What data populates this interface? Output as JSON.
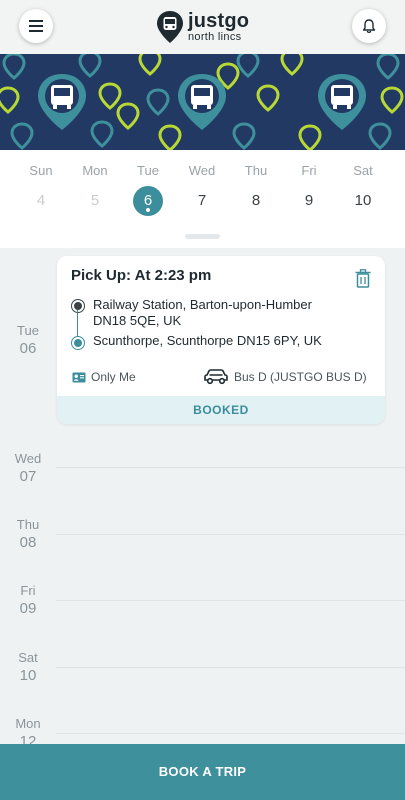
{
  "header": {
    "logo_main": "justgo",
    "logo_sub": "north lincs",
    "menu_icon": "hamburger-menu-icon",
    "bell_icon": "bell-icon"
  },
  "colors": {
    "accent": "#3d8e9c",
    "banner_bg": "#223a63",
    "pin_lime": "#b8d935",
    "pin_teal": "#3e909c",
    "agenda_bg": "#eff2f3",
    "status_bg": "#e2f1f4"
  },
  "week": {
    "days": [
      {
        "name": "Sun",
        "num": "4",
        "state": "past"
      },
      {
        "name": "Mon",
        "num": "5",
        "state": "past"
      },
      {
        "name": "Tue",
        "num": "6",
        "state": "selected"
      },
      {
        "name": "Wed",
        "num": "7",
        "state": "normal"
      },
      {
        "name": "Thu",
        "num": "8",
        "state": "normal"
      },
      {
        "name": "Fri",
        "num": "9",
        "state": "normal"
      },
      {
        "name": "Sat",
        "num": "10",
        "state": "normal"
      }
    ]
  },
  "agenda": {
    "days": [
      {
        "name": "Tue",
        "num": "06"
      },
      {
        "name": "Wed",
        "num": "07"
      },
      {
        "name": "Thu",
        "num": "08"
      },
      {
        "name": "Fri",
        "num": "09"
      },
      {
        "name": "Sat",
        "num": "10"
      },
      {
        "name": "Mon",
        "num": "12"
      }
    ],
    "trip": {
      "pickup": "Pick Up: At 2:23 pm",
      "from_line1": "Railway Station, Barton-upon-Humber",
      "from_line2": "DN18 5QE, UK",
      "to": "Scunthorpe, Scunthorpe DN15 6PY, UK",
      "passengers": "Only Me",
      "vehicle": "Bus D (JUSTGO BUS D)",
      "status": "BOOKED",
      "delete_icon": "trash-icon",
      "passenger_icon": "id-card-icon",
      "vehicle_icon": "car-icon"
    }
  },
  "book_button": "BOOK A TRIP"
}
